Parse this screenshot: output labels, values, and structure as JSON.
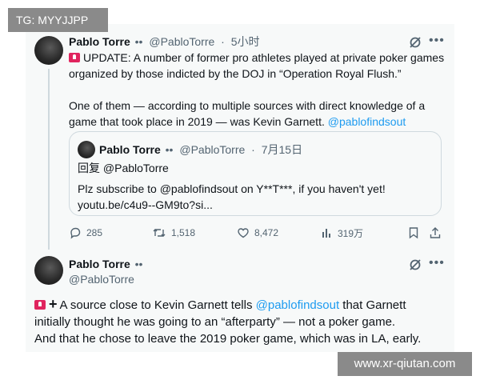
{
  "watermarks": {
    "top_left": "TG: MYYJJPP",
    "bottom_right": "www.xr-qiutan.com"
  },
  "tweet1": {
    "name": "Pablo Torre",
    "verified_dots": "••",
    "handle": "@PabloTorre",
    "sep": "·",
    "time": "5小时",
    "line1": "UPDATE: A number of former pro athletes played at private poker games",
    "line2": "organized by those indicted by the DOJ in “Operation Royal Flush.”",
    "line3": "One of them — according to multiple sources with direct knowledge of a",
    "line4_pre": "game that took place in 2019 — was Kevin Garnett. ",
    "line4_link": "@pablofindsout"
  },
  "quote": {
    "name": "Pablo Torre",
    "verified_dots": "••",
    "handle": "@PabloTorre",
    "sep": "·",
    "date": "7月15日",
    "reply_to": "回复 @PabloTorre",
    "line1": "Plz subscribe to @pablofindsout on Y**T***, if you haven't yet!",
    "line2": "youtu.be/c4u9--GM9to?si..."
  },
  "actions": {
    "replies": "285",
    "retweets": "1,518",
    "likes": "8,472",
    "views": "319万"
  },
  "tweet2": {
    "name": "Pablo Torre",
    "verified_dots": "••",
    "handle": "@PabloTorre",
    "line1_pre": "A source close to Kevin Garnett tells ",
    "line1_link": "@pablofindsout",
    "line1_post": " that Garnett",
    "line2": "initially thought he was going to an “afterparty” — not a poker game.",
    "line3": "And that he chose to leave the 2019 poker game, which was in LA, early."
  },
  "icons": {
    "more": "more-icon",
    "grok": "grok-icon",
    "reply": "reply-icon",
    "retweet": "retweet-icon",
    "like": "heart-icon",
    "views": "views-icon",
    "bookmark": "bookmark-icon",
    "share": "share-icon"
  },
  "colors": {
    "link": "#1d9bf0",
    "text": "#0f1419",
    "secondary": "#536471",
    "card_bg": "#f7f9f9"
  }
}
